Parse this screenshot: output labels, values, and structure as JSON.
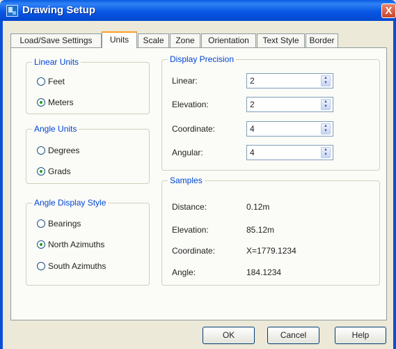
{
  "window": {
    "title": "Drawing Setup",
    "close_glyph": "X"
  },
  "tabs": [
    "Load/Save Settings",
    "Units",
    "Scale",
    "Zone",
    "Orientation",
    "Text Style",
    "Border"
  ],
  "linear_units": {
    "title": "Linear Units",
    "options": [
      "Feet",
      "Meters"
    ],
    "selected": "Meters"
  },
  "angle_units": {
    "title": "Angle Units",
    "options": [
      "Degrees",
      "Grads"
    ],
    "selected": "Grads"
  },
  "angle_display_style": {
    "title": "Angle Display Style",
    "options": [
      "Bearings",
      "North Azimuths",
      "South Azimuths"
    ],
    "selected": "North Azimuths"
  },
  "display_precision": {
    "title": "Display Precision",
    "fields": [
      {
        "label": "Linear:",
        "value": "2"
      },
      {
        "label": "Elevation:",
        "value": "2"
      },
      {
        "label": "Coordinate:",
        "value": "4"
      },
      {
        "label": "Angular:",
        "value": "4"
      }
    ]
  },
  "samples": {
    "title": "Samples",
    "rows": [
      {
        "label": "Distance:",
        "value": "0.12m"
      },
      {
        "label": "Elevation:",
        "value": "85.12m"
      },
      {
        "label": "Coordinate:",
        "value": "X=1779.1234"
      },
      {
        "label": "Angle:",
        "value": "184.1234"
      }
    ]
  },
  "buttons": {
    "ok": "OK",
    "cancel": "Cancel",
    "help": "Help"
  },
  "colors": {
    "titlebar": "#0a58e6",
    "group_title": "#0046d5",
    "selected_dot": "#21a121",
    "tab_highlight": "#ff9d22"
  }
}
